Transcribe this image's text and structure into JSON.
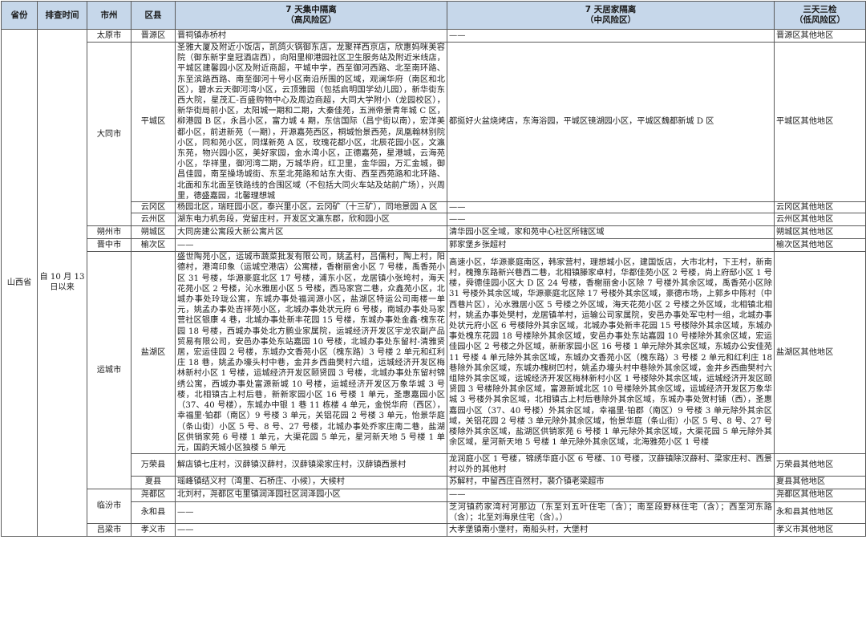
{
  "headers": {
    "province": "省份",
    "date": "排查时间",
    "city": "市州",
    "county": "区县",
    "high_title": "7 天集中隔离",
    "high_sub": "（高风险区）",
    "mid_title": "7 天居家隔离",
    "mid_sub": "（中风险区）",
    "low_title": "三天三检",
    "low_sub": "（低风险区）"
  },
  "province": "山西省",
  "date_range": "自 10 月 13 日以来",
  "cities": {
    "taiyuan": "太原市",
    "datong": "大同市",
    "shuozhou": "朔州市",
    "jinzhong": "晋中市",
    "yuncheng": "运城市",
    "linfen": "临汾市",
    "lvliang": "吕梁市"
  },
  "rows": [
    {
      "county": "晋源区",
      "high": "晋祠镇赤桥村",
      "mid": "——",
      "low": "晋源区其他地区"
    },
    {
      "county": "平城区",
      "high": "圣雅大厦及附近小饭店，凯鸽火锅御东店，龙聚祥西京店，欣惠妈咪美容院（御东新宇皇冠酒店西），向阳里柳港园社区卫生服务站及附近米线店，平城区建馨园小区及附近商超，平城中学，西至御河西路、北至南环路、东至滨路西路、南至御河十号小区南沿所围的区域，观澜华府（南区和北区），碧水云天御河湾小区，云顶雅园（包括启明国学幼儿园），新华街东西大院，星茂汇-百盛购物中心及周边商超，大同大学附小（龙园校区），新华街局前小区，太阳城一期和二期，大秦佳苑，五洲帝景青年城 C 区，柳港园 B 区，永昌小区，富力城 4 期，东信国际（昌宁街以南），宏洋美都小区，前进新苑（一期），开源嘉苑西区，桐城怡景西苑，凤凰翰林别院小区，同和苑小区，同煤新苑 A 区，玫瑰花都小区，北辰花园小区，文瀛东苑，物兴园小区，美好家园，金水湾小区，正德嘉苑，星港城，云海苑小区，华祥里，御河湾二期，万城华府，红卫里，金华园，万汇金城，御昌佳园，南至操场城街、东至北苑路和站东大街、西至西苑路和北环路、北面和东北面至铁路线的合围区域（不包括大同火车站及站前广场），兴周里，德盛嘉园，北馨理想城",
      "mid": "都挺好火盆烧烤店，东海浴园，平城区镜湖园小区，平城区魏都新城 D 区",
      "low": "平城区其他地区"
    },
    {
      "county": "云冈区",
      "high": "杨园北区，瑞旺园小区，泰兴里小区，云冈矿（十三矿），同地景园 A 区",
      "mid": "——",
      "low": "云冈区其他地区"
    },
    {
      "county": "云州区",
      "high": "湖东电力机务段，党留庄村，开发区文瀛东郡，欣和园小区",
      "mid": "——",
      "low": "云州区其他地区"
    },
    {
      "county": "朔城区",
      "high": "大同房建公寓段大新公寓片区",
      "mid": "清华园小区全域，家和苑中心社区所辖区域",
      "low": "朔城区其他地区"
    },
    {
      "county": "榆次区",
      "high": "——",
      "mid": "郭家堡乡张超村",
      "low": "榆次区其他地区"
    },
    {
      "county": "盐湖区",
      "high": "盛世陶苑小区，运城市蔬菜批发有限公司，姚孟村，吕儒村，陶上村，阳德村，港湾印象（运城空港店）公寓楼，香榭丽舍小区 7 号楼，禹香苑小区 31 号楼，华源豪庭北区 17 号楼，浦东小区，龙居镇小张垮村，海天花苑小区 2 号楼，沁水雅居小区 5 号楼，西马家宫二巷，众鑫苑小区，北城办事处玲珑公寓，东城办事处福润源小区，盐湖区特运公司南楼一单元，姚孟办事处吉祥苑小区，北城办事处状元府 6 号楼，南城办事处马家营社区银康 4 巷，北城办事处新丰花园 15 号楼，东城办事处金鑫·槐东花园 18 号楼，西城办事处北方鹏业家属院，运城经济开发区宇龙农副产品贸易有限公司，安邑办事处东站嘉园 10 号楼，北城办事处东留村-清雅贤居，宏运佳园 2 号楼，东城办文香苑小区（槐东路）3 号楼 2 单元和红利庄 18 巷，姚孟办壕头村中巷，金井乡西曲樊村六组，运城经济开发区梅林新村小区 1 号楼，运城经济开发区颐贤园 3 号楼，北城办事处东留村锦绣公寓，西城办事处富源新城 10 号楼，运城经济开发区万象华城 3 号楼，北相镇古上村后巷，新新家园小区 16 号楼 1 单元，圣惠嘉园小区（37、40 号楼），东城办中银 1 巷 11 栋楼 4 单元，金悦华府（西区），幸福里·铂郡（南区）9 号楼 3 单元，关铝花园 2 号楼 3 单元，怡景华庭（条山街）小区 5 号、8 号、27 号楼，北城办事处乔家庄南二巷，盐湖区供销家苑 6 号楼 1 单元，大渠花园 5 单元，星河新天地 5 号楼 1 单元，国韵天城小区独楼 5 单元",
      "mid": "高速小区，华源豪庭南区，韩家营村，理想城小区，建国饭店，大市北村，下王村，新南村，槐豫东路新兴巷西二巷，北相镇滕家卓村，华都佳苑小区 2 号楼，尚上府邸小区 1 号楼，舜德佳园小区大 D 区 24 号楼，香榭丽舍小区除 7 号楼外其余区域，禹香苑小区除 31 号楼外其余区域，华源豪庭北区除 17 号楼外其余区域，豪德市场，上郭乡中陈村（中西巷片区），沁水雅居小区 5 号楼之外区域，海天花苑小区 2 号楼之外区域，北相镇北相村，姚孟办事处樊村，龙居镇羊村，运输公司家属院，安邑办事处军屯村一组，北城办事处状元府小区 6 号楼除外其余区域，北城办事处新丰花园 15 号楼除外其余区域，东城办事处槐东花园 18 号楼除外其余区域，安邑办事处东站嘉园 10 号楼除外其余区域，宏运佳园小区 2 号楼之外区域，新新家园小区 16 号楼 1 单元除外其余区域，东城办公安佳苑 11 号楼 4 单元除外其余区域，东城办文香苑小区（槐东路）3 号楼 2 单元和红利庄 18 巷除外其余区域，东城办槐树凹村，姚孟办壕头村中巷除外其余区域，金井乡西曲樊村六组除外其余区域，运城经济开发区梅林新村小区 1 号楼除外其余区域，运城经济开发区颐贤园 3 号楼除外其余区域，富源新城北区 10 号楼除外其余区域，运城经济开发区万象华城 3 号楼外其余区域，北相镇古上村后巷除外其余区域，东城办事处贺村铺（西），圣惠嘉园小区（37、40 号楼）外其余区域，幸福里·铂郡（南区）9 号楼 3 单元除外其余区域，关铝花园 2 号楼 3 单元除外其余区域，怡景华庭（条山街）小区 5 号、8 号、27 号楼除外其余区域，盐湖区供销家苑 6 号楼 1 单元除外其余区域，大渠花园 5 单元除外其余区域，星河新天地 5 号楼 1 单元除外其余区域，北海雅苑小区 1 号楼",
      "low": "盐湖区其他地区"
    },
    {
      "county": "万荣县",
      "high": "解店镇七庄村，汉薛镇汉薛村，汉薛镇梁家庄村，汉薛镇西景村",
      "mid": "龙润庭小区 1 号楼，锦绣华庭小区 6 号楼、10 号楼，汉薛镇除汉薛村、梁家庄村、西景村以外的其他村",
      "low": "万荣县其他地区"
    },
    {
      "county": "夏县",
      "high": "瑶峰镇结义村（湾里、石桥庄、小候），大候村",
      "mid": "苏解村，中留西庄自然村，裴介镇老梁超市",
      "low": "夏县其他地区"
    },
    {
      "county": "尧都区",
      "high": "北刘村，尧都区屯里镇润泽园社区润泽园小区",
      "mid": "——",
      "low": "尧都区其他地区"
    },
    {
      "county": "永和县",
      "high": "——",
      "mid": "芝河镇药家湾村河那边（东至刘五叶住宅（含）；南至段野林住宅（含）；西至河东路（含）；北至刘海泉住宅（含）。）",
      "low": "永和县其他地区"
    },
    {
      "county": "孝义市",
      "high": "——",
      "mid": "大孝堡镇南小堡村，南船头村，大堡村",
      "low": "孝义市其他地区"
    }
  ]
}
